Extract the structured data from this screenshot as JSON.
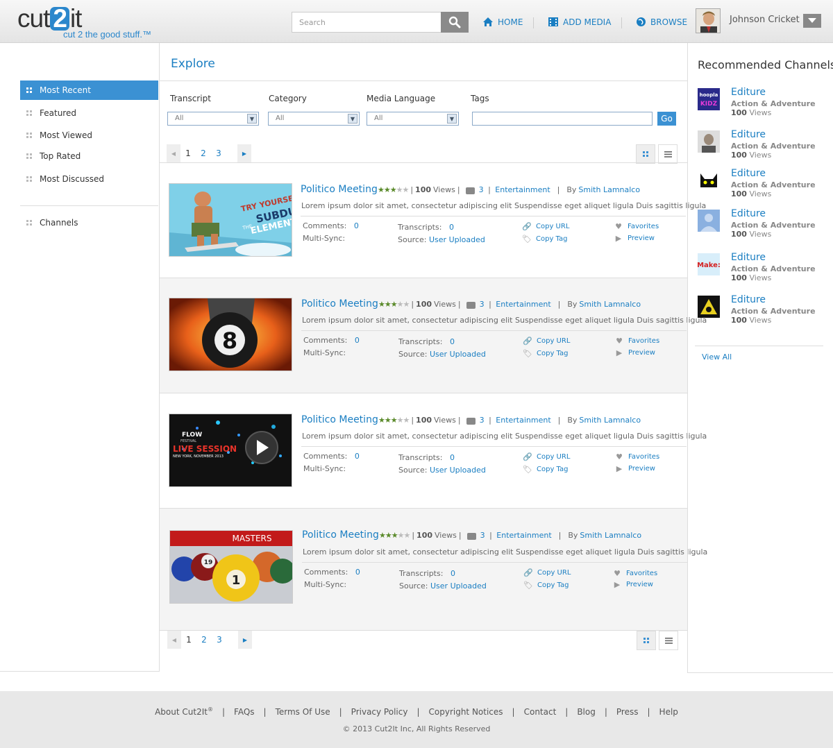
{
  "header": {
    "logo_main": "cut2it",
    "logo_tagline": "cut 2 the good stuff.™",
    "search_placeholder": "Search",
    "nav": [
      {
        "label": "HOME",
        "icon": "home-icon"
      },
      {
        "label": "ADD MEDIA",
        "icon": "film-icon"
      },
      {
        "label": "BROWSE",
        "icon": "globe-icon"
      }
    ],
    "user_name": "Johnson Cricket"
  },
  "sidebar": {
    "items": [
      {
        "label": "Most Recent",
        "active": true
      },
      {
        "label": "Featured"
      },
      {
        "label": "Most Viewed"
      },
      {
        "label": "Top Rated"
      },
      {
        "label": "Most Discussed"
      }
    ],
    "channels_label": "Channels"
  },
  "main": {
    "title": "Explore",
    "filters": [
      {
        "label": "Transcript",
        "value": "All"
      },
      {
        "label": "Category",
        "value": "All"
      },
      {
        "label": "Media Language",
        "value": "All"
      },
      {
        "label": "Tags",
        "value": ""
      }
    ],
    "go_label": "Go",
    "pages": [
      "1",
      "2",
      "3"
    ],
    "current_page": "1",
    "results": [
      {
        "title": "Politico Meeting",
        "rating": 3,
        "views": "100",
        "views_label": "Views",
        "comments_count": "3",
        "category": "Entertainment",
        "by": "By",
        "author": "Smith Lamnalco",
        "description": "Lorem ipsum dolor sit amet, consectetur adipiscing elit Suspendisse eget aliquet ligula Duis sagittis ligula",
        "comments_label": "Comments:",
        "comments_value": "0",
        "multisync_label": "Multi-Sync:",
        "transcripts_label": "Transcripts:",
        "transcripts_value": "0",
        "source_label": "Source:",
        "source_value": "User Uploaded",
        "copy_url": "Copy URL",
        "copy_tag": "Copy Tag",
        "favorites": "Favorites",
        "preview": "Preview",
        "thumb": "wakeboard"
      },
      {
        "title": "Politico Meeting",
        "rating": 3,
        "views": "100",
        "views_label": "Views",
        "comments_count": "3",
        "category": "Entertainment",
        "by": "By",
        "author": "Smith Lamnalco",
        "description": "Lorem ipsum dolor sit amet, consectetur adipiscing elit Suspendisse eget aliquet ligula Duis sagittis ligula",
        "comments_label": "Comments:",
        "comments_value": "0",
        "multisync_label": "Multi-Sync:",
        "transcripts_label": "Transcripts:",
        "transcripts_value": "0",
        "source_label": "Source:",
        "source_value": "User Uploaded",
        "copy_url": "Copy URL",
        "copy_tag": "Copy Tag",
        "favorites": "Favorites",
        "preview": "Preview",
        "thumb": "eight-ball"
      },
      {
        "title": "Politico Meeting",
        "rating": 3,
        "views": "100",
        "views_label": "Views",
        "comments_count": "3",
        "category": "Entertainment",
        "by": "By",
        "author": "Smith Lamnalco",
        "description": "Lorem ipsum dolor sit amet, consectetur adipiscing elit Suspendisse eget aliquet ligula Duis sagittis ligula",
        "comments_label": "Comments:",
        "comments_value": "0",
        "multisync_label": "Multi-Sync:",
        "transcripts_label": "Transcripts:",
        "transcripts_value": "0",
        "source_label": "Source:",
        "source_value": "User Uploaded",
        "copy_url": "Copy URL",
        "copy_tag": "Copy Tag",
        "favorites": "Favorites",
        "preview": "Preview",
        "thumb": "live-session"
      },
      {
        "title": "Politico Meeting",
        "rating": 3,
        "views": "100",
        "views_label": "Views",
        "comments_count": "3",
        "category": "Entertainment",
        "by": "By",
        "author": "Smith Lamnalco",
        "description": "Lorem ipsum dolor sit amet, consectetur adipiscing elit Suspendisse eget aliquet ligula Duis sagittis ligula",
        "comments_label": "Comments:",
        "comments_value": "0",
        "multisync_label": "Multi-Sync:",
        "transcripts_label": "Transcripts:",
        "transcripts_value": "0",
        "source_label": "Source:",
        "source_value": "User Uploaded",
        "copy_url": "Copy URL",
        "copy_tag": "Copy Tag",
        "favorites": "Favorites",
        "preview": "Preview",
        "thumb": "billiards"
      }
    ],
    "thumb_text": {
      "wakeboard_1": "TRY YOURSELF",
      "wakeboard_2": "SUBDU",
      "wakeboard_3": "THE",
      "wakeboard_4": "ELEMENT",
      "eight_ball": "8",
      "flow_1": "FLOW",
      "flow_2": "FESTIVAL",
      "flow_3": "LIVE SESSION",
      "flow_4": "NEW YORK, NOVEMBER 2013",
      "masters": "MASTERS",
      "ball_19": "19",
      "ball_1": "1"
    }
  },
  "recommended": {
    "title": "Recommended Channels",
    "channels": [
      {
        "name": "Editure",
        "category": "Action & Adventure",
        "views": "100",
        "views_label": "Views",
        "thumb_text": "hoopla KIDZ"
      },
      {
        "name": "Editure",
        "category": "Action & Adventure",
        "views": "100",
        "views_label": "Views",
        "thumb_text": ""
      },
      {
        "name": "Editure",
        "category": "Action & Adventure",
        "views": "100",
        "views_label": "Views",
        "thumb_text": ""
      },
      {
        "name": "Editure",
        "category": "Action & Adventure",
        "views": "100",
        "views_label": "Views",
        "thumb_text": ""
      },
      {
        "name": "Editure",
        "category": "Action & Adventure",
        "views": "100",
        "views_label": "Views",
        "thumb_text": "Make:"
      },
      {
        "name": "Editure",
        "category": "Action & Adventure",
        "views": "100",
        "views_label": "Views",
        "thumb_text": ""
      }
    ],
    "view_all": "View All"
  },
  "footer": {
    "links": [
      "About Cut2It",
      "FAQs",
      "Terms Of Use",
      "Privacy Policy",
      "Copyright Notices",
      "Contact",
      "Blog",
      "Press",
      "Help"
    ],
    "registered": "®",
    "copyright": "© 2013 Cut2It Inc, All Rights Reserved"
  },
  "colors": {
    "accent": "#3b91d3",
    "link": "#1a7ec2",
    "stars": "#5a8a2a"
  }
}
